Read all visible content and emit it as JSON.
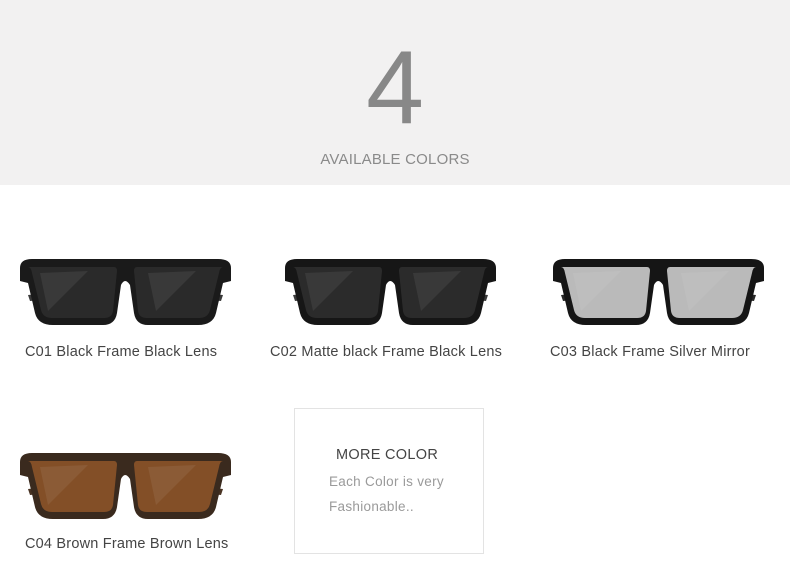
{
  "header": {
    "count": "4",
    "subtitle": "AVAILABLE COLORS"
  },
  "products": [
    {
      "caption": "C01 Black Frame Black Lens",
      "frame_color": "#1a1a1a",
      "lens_color": "#2b2b2b",
      "arm_color": "#3a3a3a"
    },
    {
      "caption": "C02  Matte black Frame Black Lens",
      "frame_color": "#161616",
      "lens_color": "#2e2e2e",
      "arm_color": "#3b3b3b"
    },
    {
      "caption": "C03 Black Frame Silver Mirror",
      "frame_color": "#151515",
      "lens_color": "#c9c9c9",
      "arm_color": "#2a2a2a"
    },
    {
      "caption": "C04 Brown Frame Brown Lens",
      "frame_color": "#3a2a1e",
      "lens_color": "#8a5328",
      "arm_color": "#4a3424"
    }
  ],
  "more": {
    "title": "MORE COLOR",
    "line1": "Each Color is very",
    "line2": "Fashionable.."
  }
}
